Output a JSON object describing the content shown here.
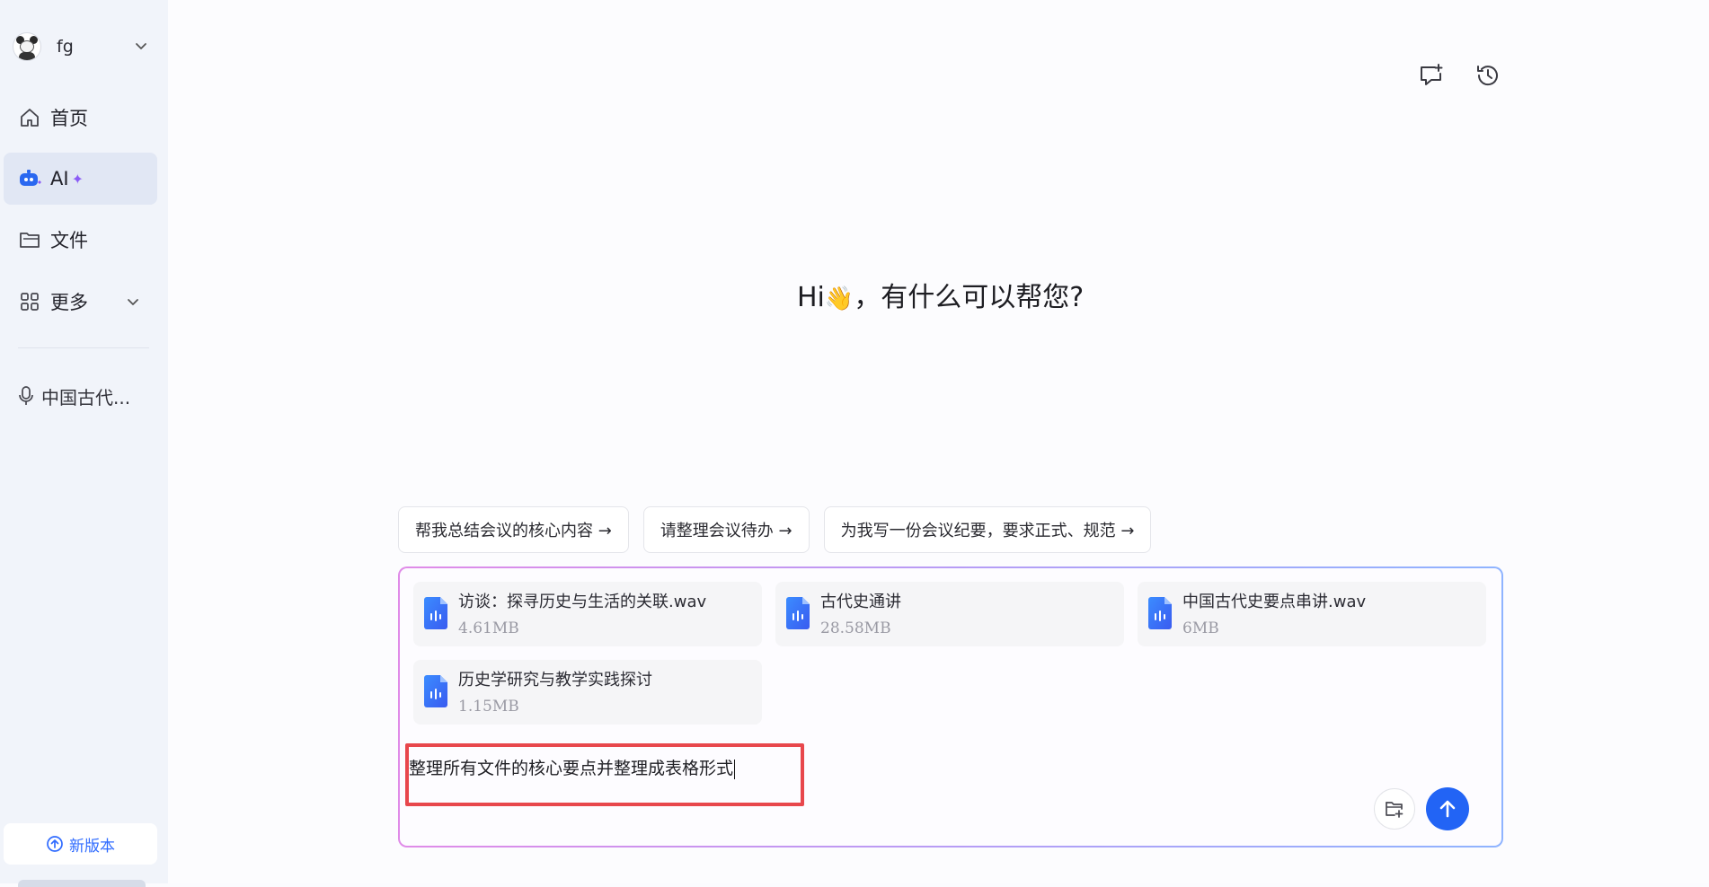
{
  "sidebar": {
    "user": {
      "name": "fg"
    },
    "nav": [
      {
        "label": "首页",
        "icon": "home-icon"
      },
      {
        "label": "AI",
        "icon": "ai-bot-icon",
        "badge": "✦"
      },
      {
        "label": "文件",
        "icon": "folder-icon"
      },
      {
        "label": "更多",
        "icon": "grid-icon"
      }
    ],
    "recent": [
      {
        "label": "中国古代...",
        "icon": "microphone-icon"
      }
    ],
    "new_version_label": "新版本"
  },
  "main": {
    "greeting_prefix": "Hi",
    "greeting_emoji": "👋",
    "greeting_suffix": "，有什么可以帮您?",
    "suggestions": [
      "帮我总结会议的核心内容 →",
      "请整理会议待办 →",
      "为我写一份会议纪要，要求正式、规范 →"
    ],
    "files": [
      {
        "name": "访谈：探寻历史与生活的关联.wav",
        "size": "4.61MB"
      },
      {
        "name": "古代史通讲",
        "size": "28.58MB"
      },
      {
        "name": "中国古代史要点串讲.wav",
        "size": "6MB"
      },
      {
        "name": "历史学研究与教学实践探讨",
        "size": "1.15MB"
      }
    ],
    "prompt_value": "整理所有文件的核心要点并整理成表格形式"
  },
  "colors": {
    "accent": "#2264f5",
    "highlight_box": "#e8474c",
    "sidebar_bg": "#f1f4fa",
    "active_nav_bg": "#e1e7f4"
  }
}
